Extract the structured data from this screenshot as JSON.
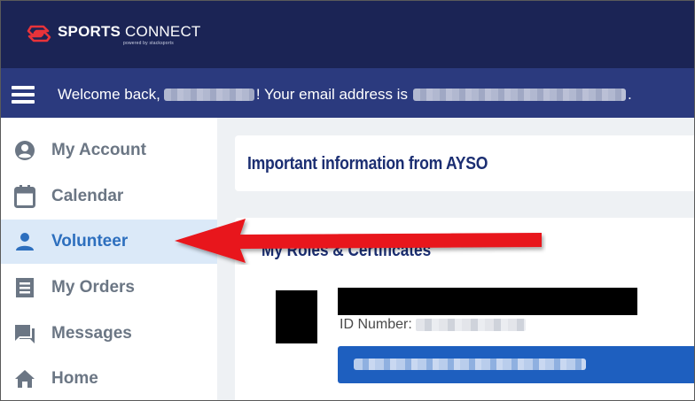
{
  "brand": {
    "name_bold": "SPORTS",
    "name_light": "CONNECT",
    "powered_by": "powered by stacksports",
    "logo_color": "#e8333a"
  },
  "welcome": {
    "prefix": "Welcome back,",
    "middle": "! Your email address is",
    "suffix": "."
  },
  "sidebar": {
    "items": [
      {
        "label": "My Account",
        "icon": "account-circle-icon"
      },
      {
        "label": "Calendar",
        "icon": "calendar-icon"
      },
      {
        "label": "Volunteer",
        "icon": "person-icon",
        "active": true
      },
      {
        "label": "My Orders",
        "icon": "receipt-icon"
      },
      {
        "label": "Messages",
        "icon": "chat-icon"
      },
      {
        "label": "Home",
        "icon": "home-icon"
      }
    ]
  },
  "main": {
    "info_title": "Important information from AYSO",
    "roles_title": "My Roles & Certificates",
    "id_label": "ID Number:"
  },
  "colors": {
    "topbar": "#1b2455",
    "welcomebar": "#2b3a7e",
    "active_nav_bg": "#dbe9f8",
    "active_nav_text": "#2d6fbe",
    "heading": "#1b2e72",
    "role_bar": "#1e5fbf",
    "arrow": "#e8141a"
  }
}
